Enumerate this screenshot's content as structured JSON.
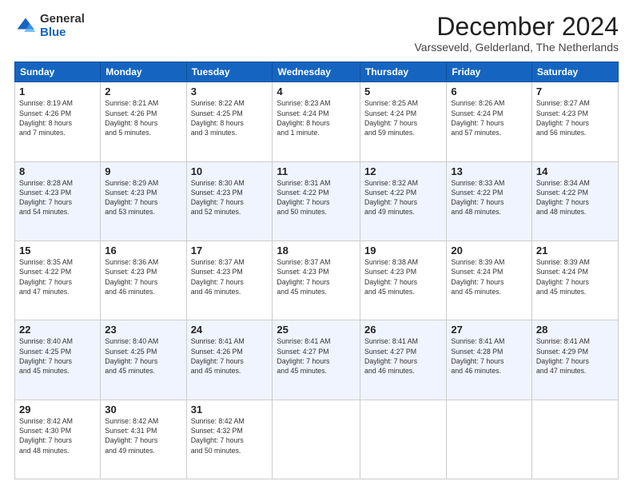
{
  "logo": {
    "general": "General",
    "blue": "Blue"
  },
  "header": {
    "month": "December 2024",
    "location": "Varsseveld, Gelderland, The Netherlands"
  },
  "weekdays": [
    "Sunday",
    "Monday",
    "Tuesday",
    "Wednesday",
    "Thursday",
    "Friday",
    "Saturday"
  ],
  "weeks": [
    [
      {
        "day": "1",
        "sunrise": "8:19 AM",
        "sunset": "4:26 PM",
        "daylight": "8 hours and 7 minutes"
      },
      {
        "day": "2",
        "sunrise": "8:21 AM",
        "sunset": "4:26 PM",
        "daylight": "8 hours and 5 minutes"
      },
      {
        "day": "3",
        "sunrise": "8:22 AM",
        "sunset": "4:25 PM",
        "daylight": "8 hours and 3 minutes"
      },
      {
        "day": "4",
        "sunrise": "8:23 AM",
        "sunset": "4:24 PM",
        "daylight": "8 hours and 1 minute"
      },
      {
        "day": "5",
        "sunrise": "8:25 AM",
        "sunset": "4:24 PM",
        "daylight": "7 hours and 59 minutes"
      },
      {
        "day": "6",
        "sunrise": "8:26 AM",
        "sunset": "4:24 PM",
        "daylight": "7 hours and 57 minutes"
      },
      {
        "day": "7",
        "sunrise": "8:27 AM",
        "sunset": "4:23 PM",
        "daylight": "7 hours and 56 minutes"
      }
    ],
    [
      {
        "day": "8",
        "sunrise": "8:28 AM",
        "sunset": "4:23 PM",
        "daylight": "7 hours and 54 minutes"
      },
      {
        "day": "9",
        "sunrise": "8:29 AM",
        "sunset": "4:23 PM",
        "daylight": "7 hours and 53 minutes"
      },
      {
        "day": "10",
        "sunrise": "8:30 AM",
        "sunset": "4:23 PM",
        "daylight": "7 hours and 52 minutes"
      },
      {
        "day": "11",
        "sunrise": "8:31 AM",
        "sunset": "4:22 PM",
        "daylight": "7 hours and 50 minutes"
      },
      {
        "day": "12",
        "sunrise": "8:32 AM",
        "sunset": "4:22 PM",
        "daylight": "7 hours and 49 minutes"
      },
      {
        "day": "13",
        "sunrise": "8:33 AM",
        "sunset": "4:22 PM",
        "daylight": "7 hours and 48 minutes"
      },
      {
        "day": "14",
        "sunrise": "8:34 AM",
        "sunset": "4:22 PM",
        "daylight": "7 hours and 48 minutes"
      }
    ],
    [
      {
        "day": "15",
        "sunrise": "8:35 AM",
        "sunset": "4:22 PM",
        "daylight": "7 hours and 47 minutes"
      },
      {
        "day": "16",
        "sunrise": "8:36 AM",
        "sunset": "4:23 PM",
        "daylight": "7 hours and 46 minutes"
      },
      {
        "day": "17",
        "sunrise": "8:37 AM",
        "sunset": "4:23 PM",
        "daylight": "7 hours and 46 minutes"
      },
      {
        "day": "18",
        "sunrise": "8:37 AM",
        "sunset": "4:23 PM",
        "daylight": "7 hours and 45 minutes"
      },
      {
        "day": "19",
        "sunrise": "8:38 AM",
        "sunset": "4:23 PM",
        "daylight": "7 hours and 45 minutes"
      },
      {
        "day": "20",
        "sunrise": "8:39 AM",
        "sunset": "4:24 PM",
        "daylight": "7 hours and 45 minutes"
      },
      {
        "day": "21",
        "sunrise": "8:39 AM",
        "sunset": "4:24 PM",
        "daylight": "7 hours and 45 minutes"
      }
    ],
    [
      {
        "day": "22",
        "sunrise": "8:40 AM",
        "sunset": "4:25 PM",
        "daylight": "7 hours and 45 minutes"
      },
      {
        "day": "23",
        "sunrise": "8:40 AM",
        "sunset": "4:25 PM",
        "daylight": "7 hours and 45 minutes"
      },
      {
        "day": "24",
        "sunrise": "8:41 AM",
        "sunset": "4:26 PM",
        "daylight": "7 hours and 45 minutes"
      },
      {
        "day": "25",
        "sunrise": "8:41 AM",
        "sunset": "4:27 PM",
        "daylight": "7 hours and 45 minutes"
      },
      {
        "day": "26",
        "sunrise": "8:41 AM",
        "sunset": "4:27 PM",
        "daylight": "7 hours and 46 minutes"
      },
      {
        "day": "27",
        "sunrise": "8:41 AM",
        "sunset": "4:28 PM",
        "daylight": "7 hours and 46 minutes"
      },
      {
        "day": "28",
        "sunrise": "8:41 AM",
        "sunset": "4:29 PM",
        "daylight": "7 hours and 47 minutes"
      }
    ],
    [
      {
        "day": "29",
        "sunrise": "8:42 AM",
        "sunset": "4:30 PM",
        "daylight": "7 hours and 48 minutes"
      },
      {
        "day": "30",
        "sunrise": "8:42 AM",
        "sunset": "4:31 PM",
        "daylight": "7 hours and 49 minutes"
      },
      {
        "day": "31",
        "sunrise": "8:42 AM",
        "sunset": "4:32 PM",
        "daylight": "7 hours and 50 minutes"
      },
      null,
      null,
      null,
      null
    ]
  ]
}
